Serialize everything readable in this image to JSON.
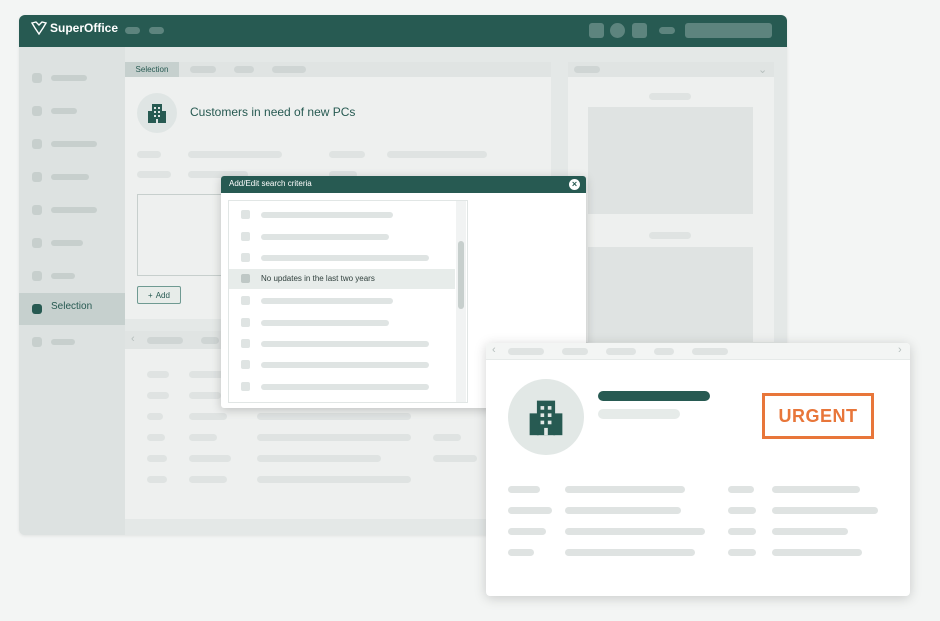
{
  "app": {
    "name": "SuperOffice"
  },
  "sidebar": {
    "active_label": "Selection"
  },
  "content": {
    "tab_label": "Selection",
    "title": "Customers in need of new PCs",
    "add_button": "Add",
    "add_icon": "+"
  },
  "dialog": {
    "title": "Add/Edit search criteria",
    "close_icon": "×",
    "highlighted_item": "No updates in the last two years"
  },
  "card": {
    "badge": "URGENT"
  },
  "icons": {
    "building": "building-icon",
    "logo": "superoffice-logo-icon"
  },
  "colors": {
    "brand": "#275a52",
    "urgent": "#e8763a",
    "background": "#f3f5f4"
  }
}
